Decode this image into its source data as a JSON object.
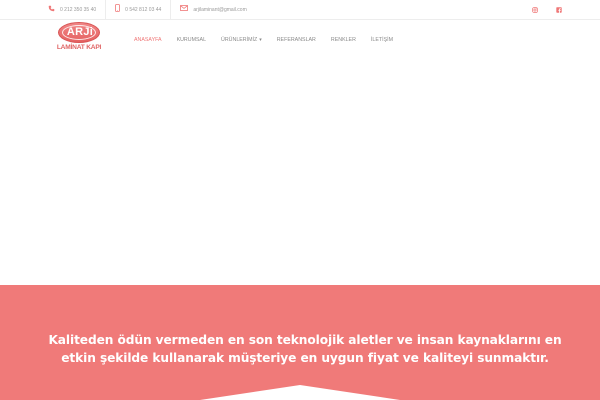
{
  "topbar": {
    "phone1": "0 212 350 35 40",
    "phone2": "0 542 812 03 44",
    "email": "arjilaminant@gmail.com",
    "icons": {
      "phone": "phone-icon",
      "mobile": "mobile-icon",
      "email": "envelope-icon",
      "instagram": "instagram-icon",
      "facebook": "facebook-icon"
    }
  },
  "logo": {
    "brand": "ARJi",
    "sub": "LAMİNAT KAPI"
  },
  "nav": {
    "items": [
      "ANASAYFA",
      "KURUMSAL",
      "ÜRÜNLERİMİZ",
      "REFERANSLAR",
      "RENKLER",
      "İLETİŞİM"
    ],
    "active": "ANASAYFA"
  },
  "banner": {
    "line1": "Kaliteden ödün vermeden en son teknolojik aletler ve insan kaynaklarını en",
    "line2": "etkin şekilde kullanarak müşteriye en uygun fiyat ve kaliteyi sunmaktır."
  },
  "colors": {
    "accent": "#ef7777",
    "banner": "#f07a79",
    "text_muted": "#9a9a9a"
  }
}
